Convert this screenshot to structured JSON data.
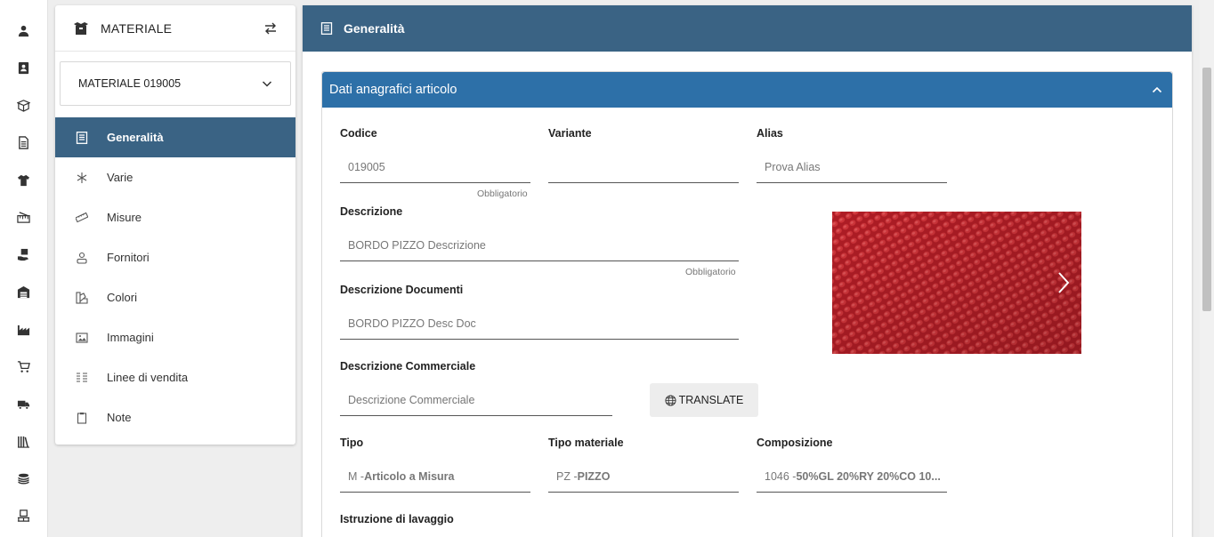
{
  "rail": {
    "icons": [
      "user-icon",
      "contact-card-icon",
      "box-open-icon",
      "document-icon",
      "tshirt-icon",
      "ruler-tag-icon",
      "hand-box-icon",
      "warehouse-icon",
      "factory-icon",
      "cart-icon",
      "truck-icon",
      "books-icon",
      "coins-icon",
      "pallet-icon"
    ]
  },
  "panel": {
    "title": "MATERIALE",
    "selector_value": "MATERIALE 019005",
    "menu": [
      {
        "label": "Generalità",
        "icon": "list-document-icon",
        "active": true
      },
      {
        "label": "Varie",
        "icon": "asterisk-icon",
        "active": false
      },
      {
        "label": "Misure",
        "icon": "ruler-icon",
        "active": false
      },
      {
        "label": "Fornitori",
        "icon": "supplier-icon",
        "active": false
      },
      {
        "label": "Colori",
        "icon": "palette-icon",
        "active": false
      },
      {
        "label": "Immagini",
        "icon": "images-icon",
        "active": false
      },
      {
        "label": "Linee di vendita",
        "icon": "lines-list-icon",
        "active": false
      },
      {
        "label": "Note",
        "icon": "clipboard-icon",
        "active": false
      }
    ]
  },
  "main": {
    "title": "Generalità",
    "card_title": "Dati anagrafici articolo"
  },
  "form": {
    "codice": {
      "label": "Codice",
      "value": "019005",
      "hint": "Obbligatorio"
    },
    "variante": {
      "label": "Variante",
      "value": ""
    },
    "alias": {
      "label": "Alias",
      "value": "Prova Alias"
    },
    "descrizione": {
      "label": "Descrizione",
      "value": "BORDO PIZZO Descrizione",
      "hint": "Obbligatorio"
    },
    "descrizione_documenti": {
      "label": "Descrizione Documenti",
      "value": "BORDO PIZZO Desc Doc"
    },
    "descrizione_commerciale": {
      "label": "Descrizione Commerciale",
      "placeholder": "Descrizione Commerciale"
    },
    "translate_label": "TRANSLATE",
    "tipo": {
      "label": "Tipo",
      "code": "M - ",
      "value": "Articolo a Misura"
    },
    "tipo_materiale": {
      "label": "Tipo materiale",
      "code": "PZ - ",
      "value": "PIZZO"
    },
    "composizione": {
      "label": "Composizione",
      "code": "1046 - ",
      "value": "50%GL 20%RY 20%CO 10..."
    },
    "istruzione_lavaggio": {
      "label": "Istruzione di lavaggio"
    }
  },
  "colors": {
    "header": "#3a6384",
    "card_header": "#2d70a8",
    "photo": "#c7252d"
  }
}
